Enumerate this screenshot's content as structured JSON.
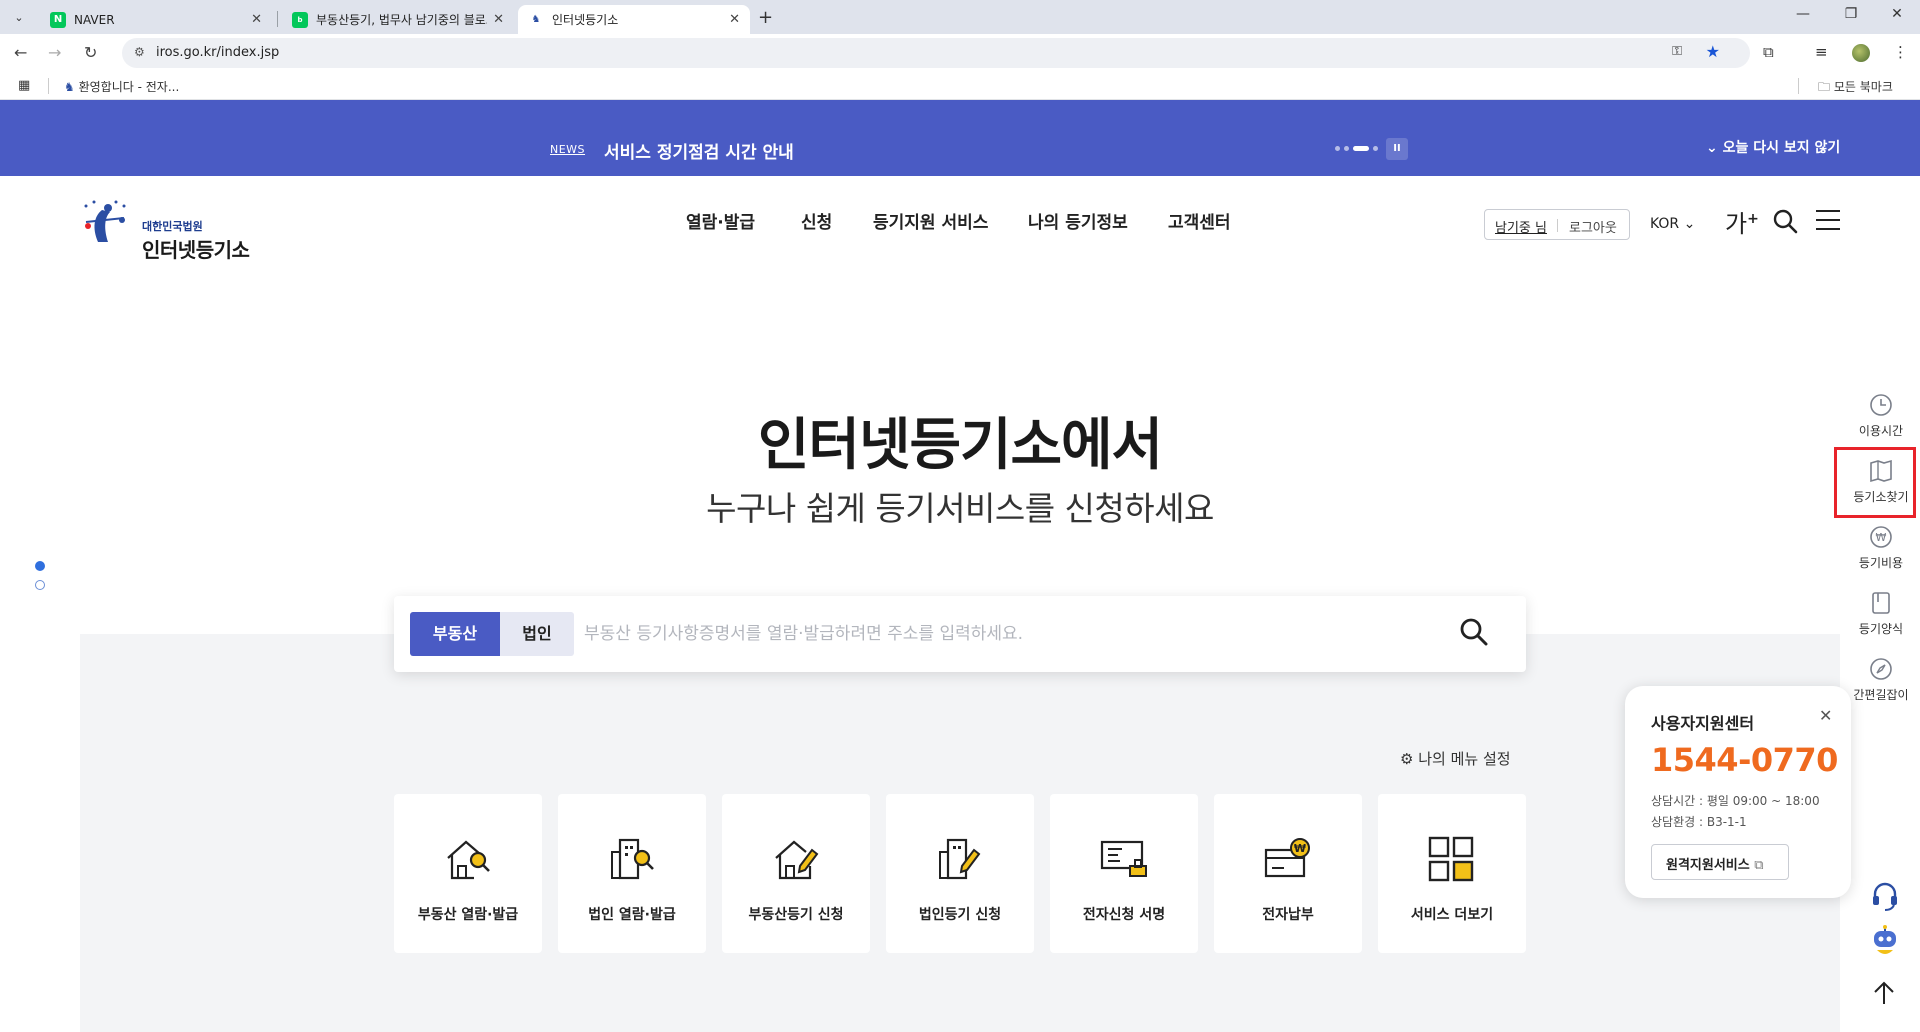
{
  "browser": {
    "tabs": [
      {
        "title": "NAVER",
        "favicon": "naver-icon"
      },
      {
        "title": "부동산등기, 법무사 남기중의 블로그",
        "favicon": "blog-icon"
      },
      {
        "title": "인터넷등기소",
        "favicon": "iros-icon"
      }
    ],
    "url": "iros.go.kr/index.jsp",
    "bookmark": "환영합니다 - 전자...",
    "all_bookmarks": "모든 북마크"
  },
  "notice": {
    "tag": "NEWS",
    "text": "서비스 정기점검 시간 안내",
    "dismiss": "오늘 다시 보지 않기"
  },
  "header": {
    "logo_sub": "대한민국법원",
    "logo_main": "인터넷등기소",
    "nav": [
      "열람·발급",
      "신청",
      "등기지원 서비스",
      "나의 등기정보",
      "고객센터"
    ],
    "user": "남기중 님",
    "logout": "로그아웃",
    "lang": "KOR",
    "font_size": "가"
  },
  "hero": {
    "title": "인터넷등기소에서",
    "subtitle": "누구나 쉽게 등기서비스를 신청하세요"
  },
  "search": {
    "tabs": [
      "부동산",
      "법인"
    ],
    "active_tab": "부동산",
    "placeholder": "부동산 등기사항증명서를 열람·발급하려면 주소를 입력하세요.",
    "value": ""
  },
  "my_menu": "나의 메뉴 설정",
  "services": [
    {
      "label": "부동산 열람·발급",
      "icon": "house-search-icon"
    },
    {
      "label": "법인 열람·발급",
      "icon": "building-search-icon"
    },
    {
      "label": "부동산등기 신청",
      "icon": "house-edit-icon"
    },
    {
      "label": "법인등기 신청",
      "icon": "building-edit-icon"
    },
    {
      "label": "전자신청 서명",
      "icon": "e-sign-icon"
    },
    {
      "label": "전자납부",
      "icon": "e-payment-icon"
    },
    {
      "label": "서비스 더보기",
      "icon": "more-grid-icon"
    }
  ],
  "quick_menu": [
    {
      "label": "이용시간",
      "icon": "clock-icon"
    },
    {
      "label": "등기소찾기",
      "icon": "map-book-icon"
    },
    {
      "label": "등기비용",
      "icon": "won-coin-icon"
    },
    {
      "label": "등기양식",
      "icon": "form-book-icon"
    },
    {
      "label": "간편길잡이",
      "icon": "compass-icon"
    }
  ],
  "support": {
    "title": "사용자지원센터",
    "phone": "1544-0770",
    "hours": "상담시간 : 평일 09:00 ~ 18:00",
    "env": "상담환경 : B3-1-1",
    "remote": "원격지원서비스"
  },
  "colors": {
    "brand": "#4a5bc4",
    "accent": "#f2c018",
    "phone": "#ef6a1f",
    "highlight": "#e8232a"
  }
}
